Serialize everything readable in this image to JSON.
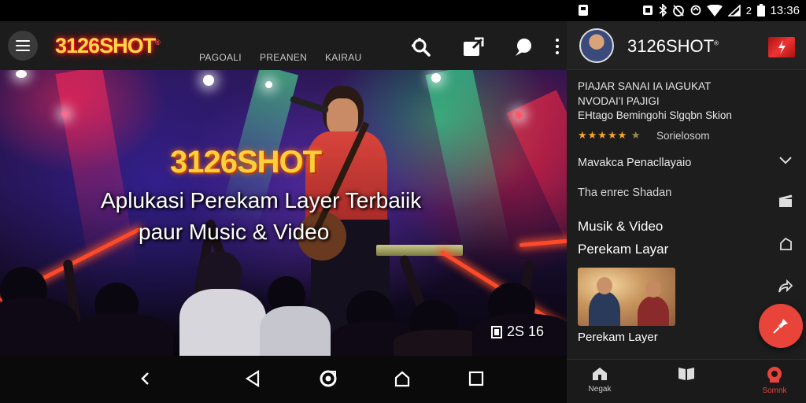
{
  "left_app": {
    "brand": "3126SHOT",
    "brand_mark": "®",
    "nav": [
      "PAGOALI",
      "PREANEN",
      "KAIRAU"
    ],
    "icons": [
      "menu-icon",
      "search-icon",
      "upload-icon",
      "chat-icon",
      "more-icon"
    ],
    "hero": {
      "title": "3126SHOT",
      "subtitle_line1": "Aplukasi Perekam Layer Terbaiik",
      "subtitle_line2": "paur Music & Video",
      "counter": "2S 16"
    },
    "system_nav": [
      "back-chevron-icon",
      "back-triangle-icon",
      "home-circle-icon",
      "home-icon",
      "recents-icon"
    ]
  },
  "status_bar": {
    "time": "13:36",
    "icons": [
      "notification-icon",
      "sim-icon",
      "bluetooth-icon",
      "alarm-icon",
      "wifi-icon",
      "signal-icon",
      "battery-icon"
    ],
    "battery_label": "2"
  },
  "right_panel": {
    "brand": "3126SHOT",
    "brand_mark": "®",
    "description": {
      "line1": "PIAJAR SANAI IA IAGUKAT",
      "line2": "NVODAI'I PAJIGI",
      "line3": "EHtago Bemingohi Slgqbn Skion"
    },
    "rating": {
      "stars": "★★★★★",
      "extra_star": "★",
      "text": "Sorielosom"
    },
    "rows": [
      {
        "label": "Mavakca Penacllayaio"
      },
      {
        "label": "Tha enrec Shadan"
      }
    ],
    "feature_lines": [
      "Musik & Video",
      "Perekam Layar"
    ],
    "thumb_label": "Perekam Layer",
    "bottom_nav": [
      {
        "label": "Negak",
        "active": false
      },
      {
        "label": "",
        "active": false
      },
      {
        "label": "Somnk",
        "active": true
      }
    ]
  }
}
